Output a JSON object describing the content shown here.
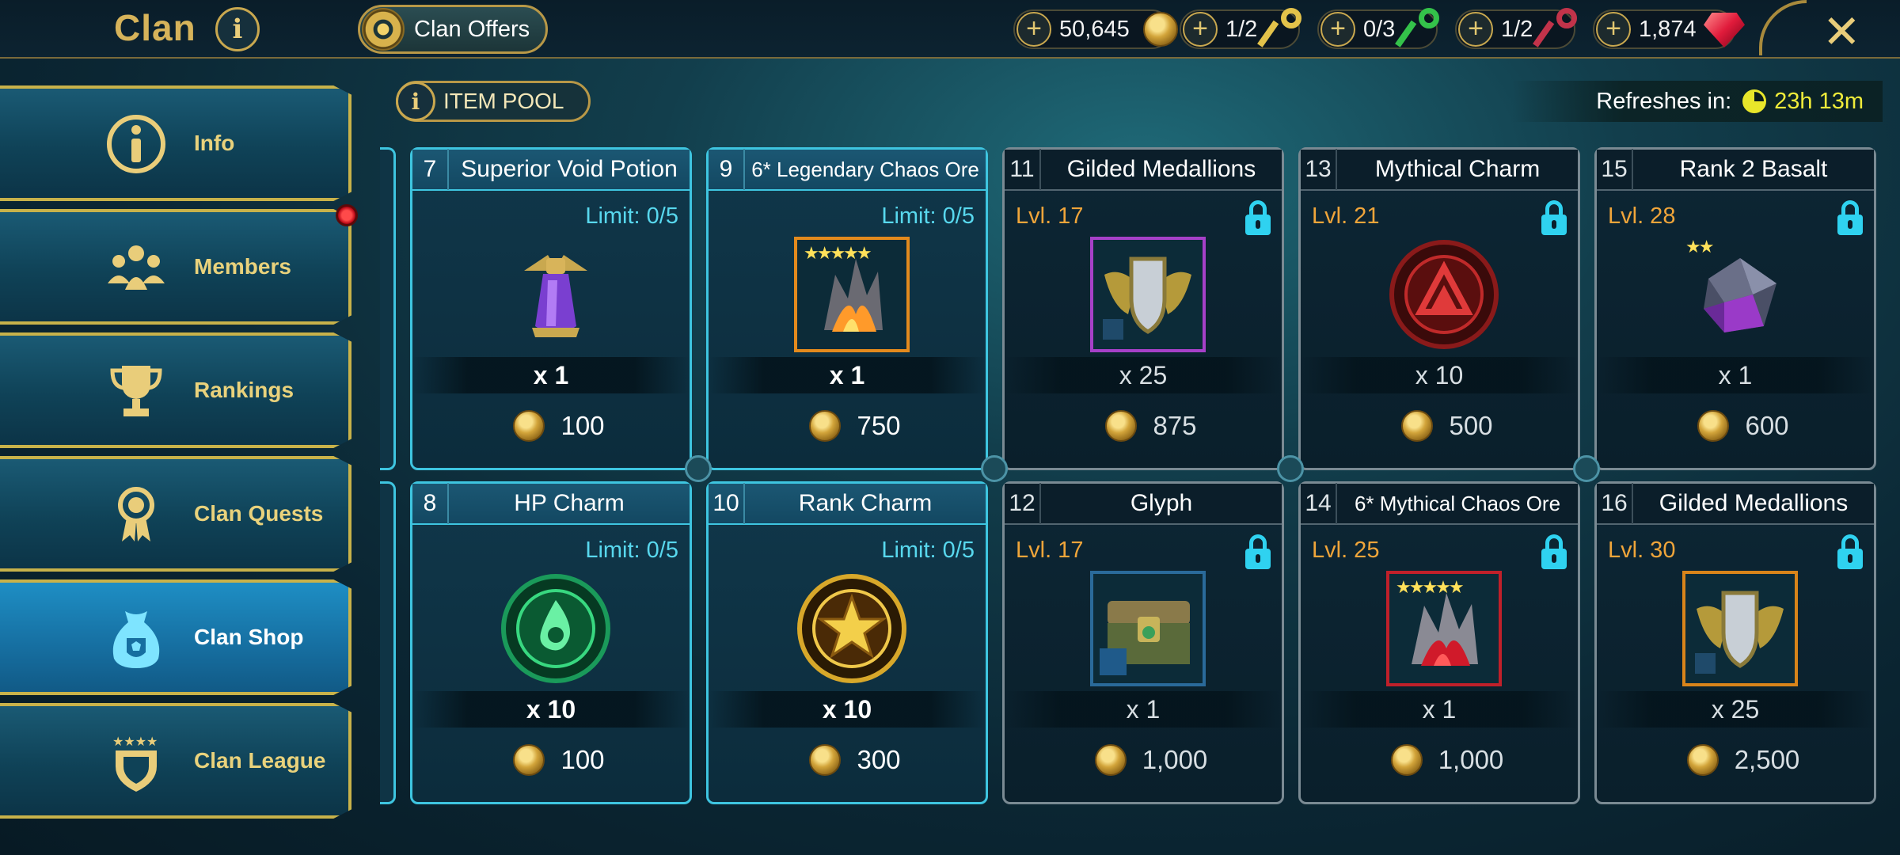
{
  "header": {
    "title": "Clan",
    "offers_label": "Clan Offers",
    "resources": [
      {
        "name": "clan-coins",
        "value": "50,645",
        "icon": "coin-icon"
      },
      {
        "name": "gold-keys",
        "value": "1/2",
        "icon": "gold-key-icon"
      },
      {
        "name": "green-keys",
        "value": "0/3",
        "icon": "green-key-icon"
      },
      {
        "name": "red-keys",
        "value": "1/2",
        "icon": "red-key-icon"
      },
      {
        "name": "gems",
        "value": "1,874",
        "icon": "ruby-icon"
      }
    ],
    "close_icon": "close-icon"
  },
  "sidebar": {
    "items": [
      {
        "label": "Info",
        "icon": "info-icon",
        "active": false
      },
      {
        "label": "Members",
        "icon": "members-icon",
        "active": false
      },
      {
        "label": "Rankings",
        "icon": "trophy-icon",
        "active": false
      },
      {
        "label": "Clan Quests",
        "icon": "medal-icon",
        "active": false
      },
      {
        "label": "Clan Shop",
        "icon": "shop-bag-icon",
        "active": true
      },
      {
        "label": "Clan League",
        "icon": "shield-stars-icon",
        "active": false
      }
    ]
  },
  "toolbar": {
    "item_pool_label": "ITEM POOL",
    "refresh_label": "Refreshes in:",
    "refresh_value": "23h 13m"
  },
  "shop": {
    "items": [
      {
        "num": "7",
        "name": "Superior Void Potion",
        "limit": "Limit: 0/5",
        "qty": "x 1",
        "price": "100",
        "locked": false,
        "icon": "void-potion-icon"
      },
      {
        "num": "9",
        "name": "6* Legendary Chaos Ore",
        "limit": "Limit: 0/5",
        "qty": "x 1",
        "price": "750",
        "locked": false,
        "icon": "chaos-ore-icon",
        "stars": "★★★★★"
      },
      {
        "num": "11",
        "name": "Gilded Medallions",
        "level": "Lvl. 17",
        "qty": "x 25",
        "price": "875",
        "locked": true,
        "icon": "medallion-icon"
      },
      {
        "num": "13",
        "name": "Mythical Charm",
        "level": "Lvl. 21",
        "qty": "x 10",
        "price": "500",
        "locked": true,
        "icon": "mythical-charm-icon"
      },
      {
        "num": "15",
        "name": "Rank 2 Basalt",
        "level": "Lvl. 28",
        "qty": "x 1",
        "price": "600",
        "locked": true,
        "icon": "basalt-icon",
        "stars": "★★"
      },
      {
        "num": "8",
        "name": "HP Charm",
        "limit": "Limit: 0/5",
        "qty": "x 10",
        "price": "100",
        "locked": false,
        "icon": "hp-charm-icon"
      },
      {
        "num": "10",
        "name": "Rank Charm",
        "limit": "Limit: 0/5",
        "qty": "x 10",
        "price": "300",
        "locked": false,
        "icon": "rank-charm-icon"
      },
      {
        "num": "12",
        "name": "Glyph",
        "level": "Lvl. 17",
        "qty": "x 1",
        "price": "1,000",
        "locked": true,
        "icon": "glyph-chest-icon"
      },
      {
        "num": "14",
        "name": "6* Mythical Chaos Ore",
        "level": "Lvl. 25",
        "qty": "x 1",
        "price": "1,000",
        "locked": true,
        "icon": "mythical-ore-icon",
        "stars": "★★★★★"
      },
      {
        "num": "16",
        "name": "Gilded Medallions",
        "level": "Lvl. 30",
        "qty": "x 25",
        "price": "2,500",
        "locked": true,
        "icon": "medallion-icon"
      }
    ]
  }
}
